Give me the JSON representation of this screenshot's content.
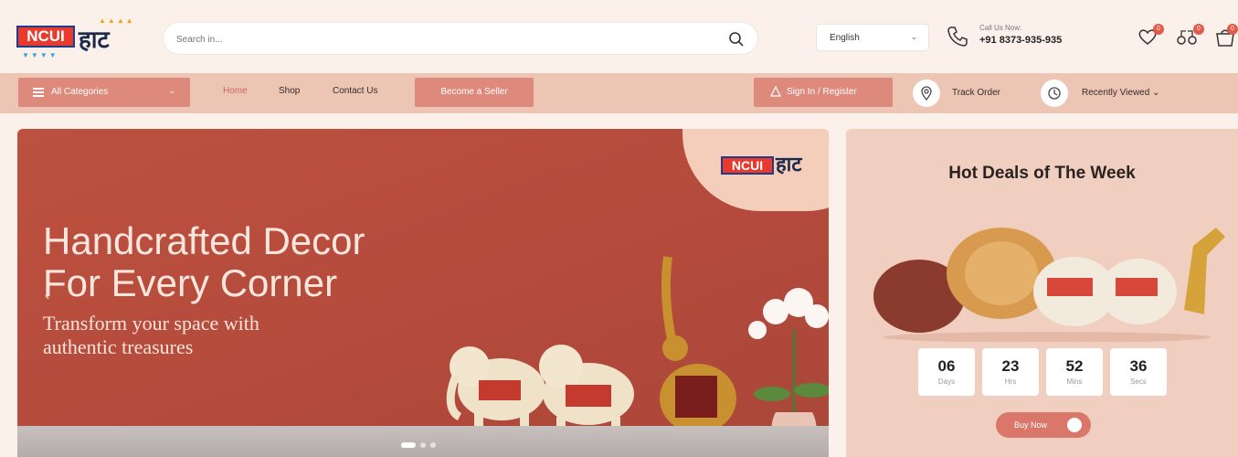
{
  "header": {
    "logo_text": "NCUI",
    "logo_hindi": "हाट",
    "search_placeholder": "Search in...",
    "language": "English",
    "call_label": "Call Us Now:",
    "call_number": "+91 8373-935-935",
    "wishlist_count": "0",
    "compare_count": "0",
    "cart_count": "0"
  },
  "nav": {
    "all_categories": "All Categories",
    "links": [
      "Home",
      "Shop",
      "Contact Us"
    ],
    "become_seller": "Become a Seller",
    "sign_in": "Sign In / Register",
    "track_order": "Track Order",
    "recently_viewed": "Recently Viewed"
  },
  "hero": {
    "title_line1": "Handcrafted Decor",
    "title_line2": "For Every Corner",
    "subtitle_line1": "Transform your space with",
    "subtitle_line2": "authentic treasures",
    "slide_count": 3,
    "active_slide": 1
  },
  "deals": {
    "title": "Hot Deals of The Week",
    "countdown": [
      {
        "value": "06",
        "unit": "Days"
      },
      {
        "value": "23",
        "unit": "Hrs"
      },
      {
        "value": "52",
        "unit": "Mins"
      },
      {
        "value": "36",
        "unit": "Secs"
      }
    ],
    "shop_now": "Buy Now"
  },
  "colors": {
    "accent": "#dd8a7c",
    "navbar_bg": "#ecc5b5",
    "hero_bg": "#b34a3b",
    "page_bg": "#fbf1ea"
  }
}
